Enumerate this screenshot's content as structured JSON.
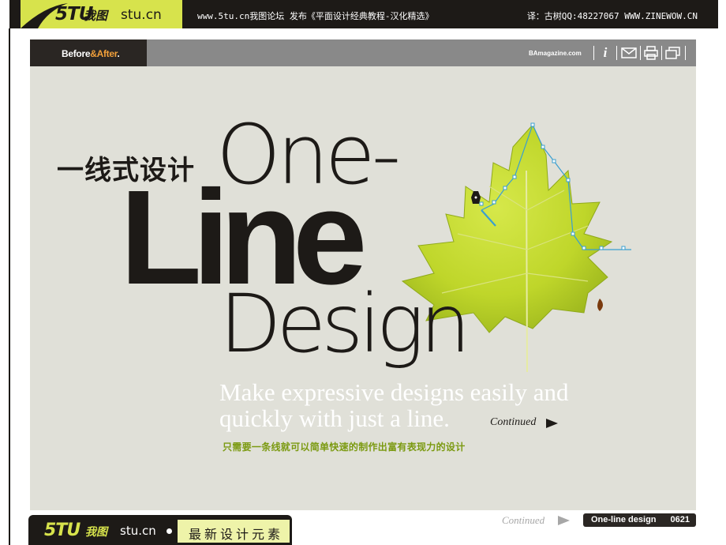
{
  "top_banner": {
    "logo_mark": "5TU",
    "logo_cn": "我图",
    "logo_url": "stu.cn",
    "publish_text": "www.5tu.cn我图论坛 发布《平面设计经典教程-汉化精选》",
    "credit_text": "译：古树QQ:48227067 WWW.ZINEWOW.CN"
  },
  "magazine": {
    "brand_before": "Before",
    "brand_amp": "&",
    "brand_after": "After",
    "brand_dot": ".",
    "site": "BAmagazine.com",
    "icons": [
      "info-icon",
      "mail-icon",
      "print-icon",
      "window-icon"
    ],
    "title_cn": "一线式设计",
    "title_line1": "One-",
    "title_line2": "Line",
    "title_line3": "Design",
    "subtitle_en": "Make expressive designs easily and quickly with just a line.",
    "continued": "Continued",
    "subtitle_cn": "只需要一条线就可以简单快速的制作出富有表现力的设计"
  },
  "footer": {
    "continued": "Continued",
    "article_title": "One-line design",
    "page_number": "0621",
    "logo_mark": "5TU",
    "logo_cn": "我图",
    "logo_url": "stu.cn",
    "tag": "最新设计元素"
  },
  "colors": {
    "banner_dark": "#1d1a17",
    "logo_green": "#d7e34c",
    "page_bg": "#e0e0d8",
    "leaf_green": "#bfd62a",
    "path_blue": "#3a9fd0",
    "cn_sub_green": "#7b9a11"
  }
}
